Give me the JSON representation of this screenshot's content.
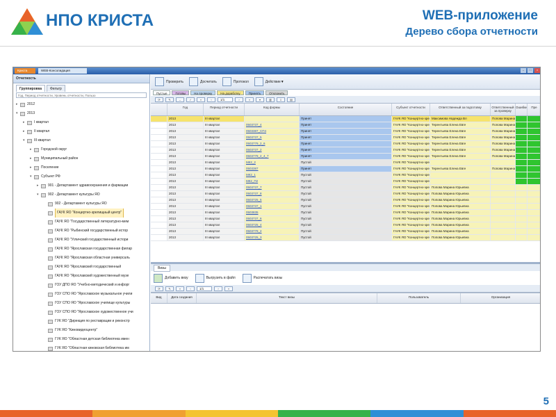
{
  "slide": {
    "company": "НПО КРИСТА",
    "title": "WEB-приложение",
    "subtitle": "Дерево сбора отчетности",
    "page_number": "5"
  },
  "window": {
    "app_tab": "Криста",
    "tab_title": "WEB-Консолидация"
  },
  "left_panel": {
    "header": "Отчетность",
    "tabs": [
      "Группировка",
      "Фильтр"
    ],
    "search_placeholder": "Год, Период отчетности, Уровень отчетности, Пользо",
    "tree": [
      {
        "label": "2012",
        "level": 0,
        "toggle": "+"
      },
      {
        "label": "2013",
        "level": 0,
        "toggle": "-"
      },
      {
        "label": "I квартал",
        "level": 1,
        "toggle": "+"
      },
      {
        "label": "II квартал",
        "level": 1,
        "toggle": "+"
      },
      {
        "label": "III квартал",
        "level": 1,
        "toggle": "-"
      },
      {
        "label": "Городской округ",
        "level": 2,
        "toggle": "+"
      },
      {
        "label": "Муниципальный район",
        "level": 2,
        "toggle": "+"
      },
      {
        "label": "Поселение",
        "level": 2,
        "toggle": "+"
      },
      {
        "label": "Субъект РФ",
        "level": 2,
        "toggle": "-"
      },
      {
        "label": "901 - Департамент здравоохранения и фармации",
        "level": 3,
        "toggle": "+"
      },
      {
        "label": "902 - Департамент культуры ЯО",
        "level": 3,
        "toggle": "-"
      },
      {
        "label": "902 - Департамент культуры ЯО",
        "level": 4,
        "toggle": ""
      },
      {
        "label": "ГАУК ЯО \"Концертно-зрелищный центр\"",
        "level": 4,
        "toggle": "",
        "selected": true
      },
      {
        "label": "ГАУК ЯО \"Государственный литературно-мем",
        "level": 4,
        "toggle": ""
      },
      {
        "label": "ГАУК ЯО \"Рыбинский государственный истор",
        "level": 4,
        "toggle": ""
      },
      {
        "label": "ГАУК ЯО \"Угличский государственный истори",
        "level": 4,
        "toggle": ""
      },
      {
        "label": "ГАУК ЯО \"Ярославская государственная филар",
        "level": 4,
        "toggle": ""
      },
      {
        "label": "ГАУК ЯО \"Ярославская областная универсаль",
        "level": 4,
        "toggle": ""
      },
      {
        "label": "ГАУК ЯО \"Ярославский государственный",
        "level": 4,
        "toggle": ""
      },
      {
        "label": "ГАУК ЯО \"Ярославский художественный музе",
        "level": 4,
        "toggle": ""
      },
      {
        "label": "ГОУ ДПО ЯО \"Учебно-методический и инфорг",
        "level": 4,
        "toggle": ""
      },
      {
        "label": "ГОУ СПО ЯО \"Ярославское музыкальное учили",
        "level": 4,
        "toggle": ""
      },
      {
        "label": "ГОУ СПО ЯО \"Ярославское училище культуры",
        "level": 4,
        "toggle": ""
      },
      {
        "label": "ГОУ СПО ЯО \"Ярославское художественное учи",
        "level": 4,
        "toggle": ""
      },
      {
        "label": "ГУК ЯО \"Дирекция по реставрации и реконстр",
        "level": 4,
        "toggle": ""
      },
      {
        "label": "ГУК ЯО \"Киновидеоцентр\"",
        "level": 4,
        "toggle": ""
      },
      {
        "label": "ГУК ЯО \"Областная детская библиотека имен",
        "level": 4,
        "toggle": ""
      },
      {
        "label": "ГУК ЯО \"Областная киновская библиотека им",
        "level": 4,
        "toggle": ""
      },
      {
        "label": "ГУК ЯО \"Областной Дом народного творчеств",
        "level": 4,
        "toggle": ""
      }
    ]
  },
  "toolbar": {
    "check": "Проверить",
    "sign": "Досчитать",
    "protocol": "Протокол",
    "action": "Действие"
  },
  "status_filters": [
    {
      "label": "Пустые",
      "color": "#ffffff"
    },
    {
      "label": "Готовы",
      "color": "#d7b6e6"
    },
    {
      "label": "На проверку",
      "color": "#bcd6f0"
    },
    {
      "label": "На доработку",
      "color": "#f5e68a"
    },
    {
      "label": "Принять",
      "color": "#a9c7ee"
    },
    {
      "label": "Отклонить",
      "color": "#d8d8d8"
    }
  ],
  "pager": {
    "value": "1/1"
  },
  "grid": {
    "headers": [
      "Год",
      "Период отчетности",
      "Код формы",
      "Состояние",
      "Субъект отчетности",
      "Ответственный за подготовку",
      "Ответственный за проверку",
      "Ошибки",
      "Пре"
    ],
    "rows": [
      [
        "2013",
        "III квартал",
        "",
        "Принят",
        "ГАУК ЯО \"Концертно-зрелищный центр\"",
        "Максимова Надежда Вл",
        "Попова Марина Владимиров",
        "",
        ""
      ],
      [
        "2013",
        "III квартал",
        "0503737_4",
        "Принят",
        "ГАУК ЯО \"Концертно-зрелищный центр\"",
        "Терентьева Елена Евге",
        "Попова Марина Юрьевна",
        "",
        ""
      ],
      [
        "2013",
        "III квартал",
        "0503387_СП4",
        "Принят",
        "ГАУК ЯО \"Концертно-зрелищный центр\"",
        "Терентьева Елена Евге",
        "Попова Марина Юрьевна",
        "",
        ""
      ],
      [
        "2013",
        "III квартал",
        "0503737_5",
        "Принят",
        "ГАУК ЯО \"Концертно-зрелищный центр\"",
        "Терентьева Елена Евге",
        "Попова Марина Юрьевна",
        "",
        ""
      ],
      [
        "2013",
        "III квартал",
        "0503779_2_6",
        "Принят",
        "ГАУК ЯО \"Концертно-зрелищный центр\"",
        "Терентьева Елена Евге",
        "Попова Марина Юрьевна",
        "",
        ""
      ],
      [
        "2013",
        "III квартал",
        "0503737_2",
        "Принят",
        "ГАУК ЯО \"Концертно-зрелищный центр\"",
        "Терентьева Елена Евге",
        "Попова Марина Юрьевна",
        "",
        ""
      ],
      [
        "2013",
        "III квартал",
        "0503779_2_4_7",
        "Принят",
        "ГАУК ЯО \"Концертно-зрелищный центр\"",
        "Терентьева Елена Евге",
        "Попова Марина Юрьевна",
        "",
        ""
      ],
      [
        "2013",
        "III квартал",
        "МК2_2",
        "Пустой",
        "ГАУК ЯО \"Концертно-зрелищный центр\"",
        "",
        "",
        "",
        ""
      ],
      [
        "2013",
        "III квартал",
        "0503387",
        "Принят",
        "ГАУК ЯО \"Концертно-зрелищный центр\"",
        "Терентьева Елена Евге",
        "Попова Марина Юрьевна",
        "",
        ""
      ],
      [
        "2013",
        "III квартал",
        "МК2_1",
        "Пустой",
        "ГАУК ЯО \"Концертно-зрелищный центр\"",
        "",
        "",
        "",
        ""
      ],
      [
        "2013",
        "III квартал",
        "МК2_П2",
        "Пустой",
        "ГАУК ЯО \"Концертно-зрелищный центр\"",
        "",
        "",
        "",
        ""
      ],
      [
        "2013",
        "III квартал",
        "0503737_7",
        "Пустой",
        "ГАУК ЯО \"Концертно-зрелищный центр\"",
        "Попова Марина Юрьевна",
        "",
        "",
        ""
      ],
      [
        "2013",
        "III квартал",
        "0503737_8",
        "Пустой",
        "ГАУК ЯО \"Концертно-зрелищный центр\"",
        "Попова Марина Юрьевна",
        "",
        "",
        ""
      ],
      [
        "2013",
        "III квартал",
        "0503725_5",
        "Пустой",
        "ГАУК ЯО \"Концертно-зрелищный центр\"",
        "Попова Марина Юрьевна",
        "",
        "",
        ""
      ],
      [
        "2013",
        "III квартал",
        "0503737_1",
        "Пустой",
        "ГАУК ЯО \"Концертно-зрелищный центр\"",
        "Попова Марина Юрьевна",
        "",
        "",
        ""
      ],
      [
        "2013",
        "III квартал",
        "0503835",
        "Пустой",
        "ГАУК ЯО \"Концертно-зрелищный центр\"",
        "Попова Марина Юрьевна",
        "",
        "",
        ""
      ],
      [
        "2013",
        "III квартал",
        "0503737_6",
        "Пустой",
        "ГАУК ЯО \"Концертно-зрелищный центр\"",
        "Попова Марина Юрьевна",
        "",
        "",
        ""
      ],
      [
        "2013",
        "III квартал",
        "0503725_4",
        "Пустой",
        "ГАУК ЯО \"Концертно-зрелищный центр\"",
        "Попова Марина Юрьевна",
        "",
        "",
        ""
      ],
      [
        "2013",
        "III квартал",
        "0503779_2",
        "Пустой",
        "ГАУК ЯО \"Концертно-зрелищный центр\"",
        "Попова Марина Юрьевна",
        "",
        "",
        ""
      ],
      [
        "2013",
        "III квартал",
        "0503725_3",
        "Пустой",
        "ГАУК ЯО \"Концертно-зрелищный центр\"",
        "Попова Марина Юрьевна",
        "",
        "",
        ""
      ]
    ]
  },
  "visa": {
    "tab": "Визы",
    "add": "Добавить визу",
    "export": "Выгрузить в файл",
    "print": "Распечатать визы",
    "pager": "1/1",
    "headers": [
      "Вид",
      "Дата создания",
      "Текст визы",
      "Пользователь",
      "Организация"
    ]
  },
  "colors": {
    "brand": "#1f6fb5",
    "accepted": "#a9c7ee",
    "empty": "#e6e6e6",
    "error_green": "#2fc52f",
    "row_yellow": "#f7f3b8"
  }
}
